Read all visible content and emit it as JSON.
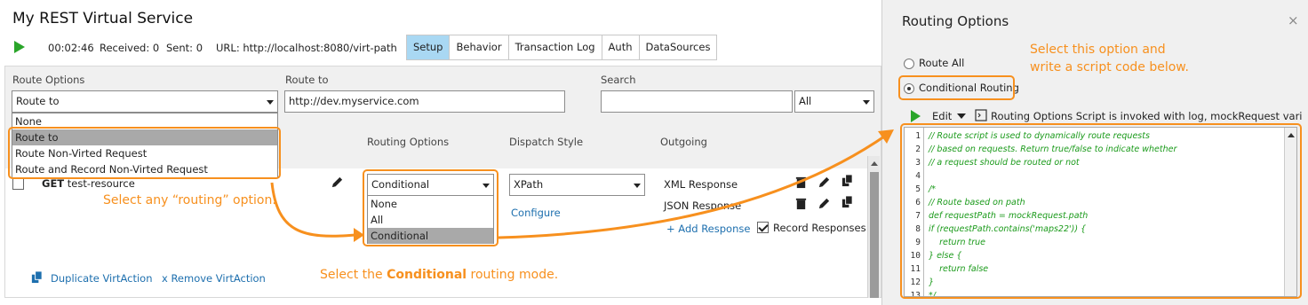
{
  "service": {
    "title": "My REST Virtual Service",
    "elapsed": "00:02:46",
    "received": "Received: 0",
    "sent": "Sent: 0",
    "url": "URL: http://localhost:8080/virt-path",
    "tabs": [
      "Setup",
      "Behavior",
      "Transaction Log",
      "Auth",
      "DataSources"
    ],
    "active_tab": "Setup"
  },
  "filters": {
    "route_options_label": "Route Options",
    "route_options_value": "Route to",
    "route_options_list": [
      "None",
      "Route to",
      "Route Non-Virted Request",
      "Route and Record Non-Virted Request"
    ],
    "route_options_selected": "Route to",
    "route_to_label": "Route to",
    "route_to_value": "http://dev.myservice.com",
    "search_label": "Search",
    "search_value": "",
    "search_scope": "All"
  },
  "columns": {
    "routing_options": "Routing Options",
    "dispatch_style": "Dispatch Style",
    "outgoing": "Outgoing"
  },
  "virtaction": {
    "method": "GET",
    "resource": "test-resource",
    "routing_value": "Conditional",
    "routing_list": [
      "None",
      "All",
      "Conditional"
    ],
    "routing_selected": "Conditional",
    "dispatch_value": "XPath",
    "configure": "Configure",
    "responses": [
      "XML Response",
      "JSON Response"
    ],
    "add_response": "+ Add Response",
    "record_responses": "Record Responses",
    "record_checked": true
  },
  "footer": {
    "duplicate": "Duplicate VirtAction",
    "remove": "x Remove VirtAction"
  },
  "callouts": {
    "select_routing": "Select any “routing” option.",
    "select_conditional_prefix": "Select the ",
    "select_conditional_bold": "Conditional",
    "select_conditional_suffix": " routing mode.",
    "select_option_line1": "Select this option and",
    "select_option_line2": "write a script code below."
  },
  "routing_panel": {
    "title": "Routing Options",
    "close": "×",
    "route_all": "Route All",
    "conditional": "Conditional Routing",
    "selected": "Conditional Routing",
    "edit": "Edit",
    "script_info": "Routing Options Script is invoked with log, mockRequest variab",
    "code_lines": [
      "// Route script is used to dynamically route requests",
      "// based on requests. Return true/false to indicate whether",
      "// a request should be routed or not",
      "",
      "/*",
      "// Route based on path",
      "def requestPath = mockRequest.path",
      "if (requestPath.contains('maps22')) {",
      "    return true",
      "} else {",
      "    return false",
      "}",
      "*/"
    ],
    "line_numbers": [
      "1",
      "2",
      "3",
      "4",
      "5",
      "6",
      "7",
      "8",
      "9",
      "10",
      "11",
      "12",
      "13"
    ]
  },
  "colors": {
    "accent": "#f7901e",
    "tab_active": "#a9d8f3",
    "code_comment": "#1a9a1a",
    "play": "#2aa52a",
    "link": "#1d6fae"
  },
  "icons": [
    "play-icon",
    "pencil-icon",
    "trash-icon",
    "copy-icon",
    "dropdown-arrow-icon",
    "script-icon",
    "close-icon"
  ]
}
